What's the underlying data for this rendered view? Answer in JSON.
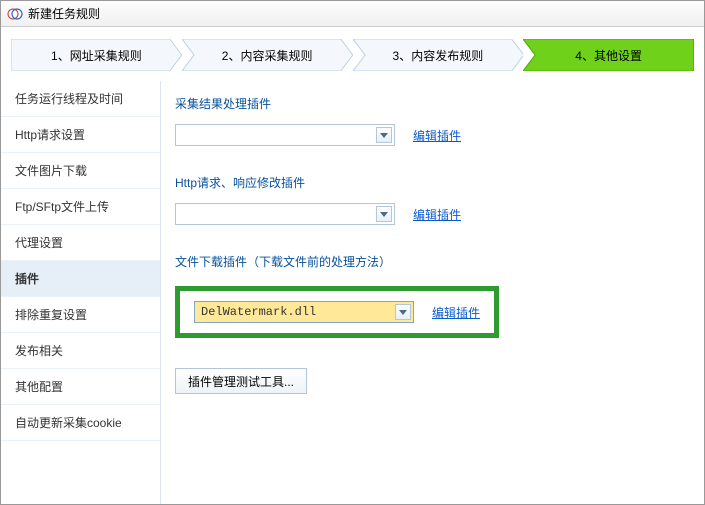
{
  "window": {
    "title": "新建任务规则"
  },
  "steps": [
    {
      "label": "1、网址采集规则",
      "active": false
    },
    {
      "label": "2、内容采集规则",
      "active": false
    },
    {
      "label": "3、内容发布规则",
      "active": false
    },
    {
      "label": "4、其他设置",
      "active": true
    }
  ],
  "sidebar": {
    "items": [
      {
        "label": "任务运行线程及时间"
      },
      {
        "label": "Http请求设置"
      },
      {
        "label": "文件图片下载"
      },
      {
        "label": "Ftp/SFtp文件上传"
      },
      {
        "label": "代理设置"
      },
      {
        "label": "插件"
      },
      {
        "label": "排除重复设置"
      },
      {
        "label": "发布相关"
      },
      {
        "label": "其他配置"
      },
      {
        "label": "自动更新采集cookie"
      }
    ],
    "active_index": 5
  },
  "content": {
    "section1": {
      "title": "采集结果处理插件",
      "value": "",
      "edit_label": "编辑插件"
    },
    "section2": {
      "title": "Http请求、响应修改插件",
      "value": "",
      "edit_label": "编辑插件"
    },
    "section3": {
      "title": "文件下载插件（下载文件前的处理方法）",
      "value": "DelWatermark.dll",
      "edit_label": "编辑插件"
    },
    "manage_button": "插件管理测试工具..."
  }
}
